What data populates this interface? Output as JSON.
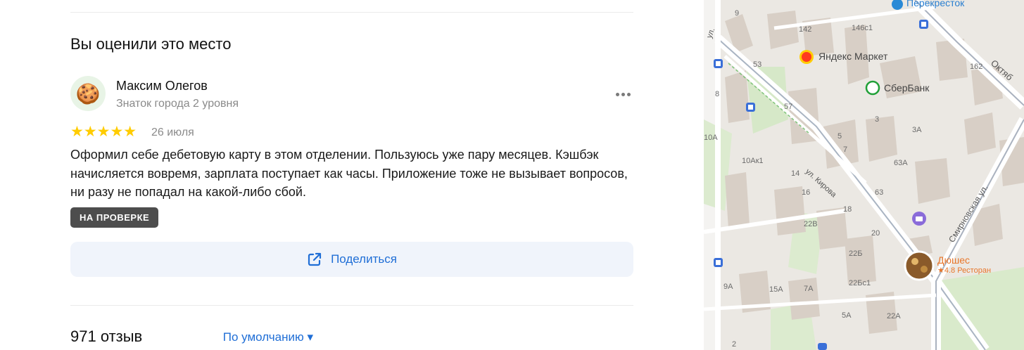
{
  "review_section": {
    "title": "Вы оценили это место",
    "author": {
      "name": "Максим Олегов",
      "level": "Знаток города 2 уровня",
      "avatar_emoji": "🍪"
    },
    "rating_stars": "★★★★★",
    "date": "26 июля",
    "text": "Оформил себе дебетовую карту в этом отделении. Пользуюсь уже пару месяцев. Кэшбэк начисляется вовремя, зарплата поступает как часы. Приложение тоже не вызывает вопросов, ни разу не попадал на какой-либо сбой.",
    "status_badge": "НА ПРОВЕРКЕ",
    "share_label": "Поделиться"
  },
  "reviews_header": {
    "count": "971 отзыв",
    "sort_label": "По умолчанию ▾"
  },
  "map": {
    "pois": {
      "perekrestok": "Перекресток",
      "yandex_market": "Яндекс Маркет",
      "sberbank": "СберБанк",
      "restaurant_name": "Дюшес",
      "restaurant_rating": "★4.8 Ресторан"
    },
    "streets": {
      "kirova": "ул. Кирова",
      "smirnovskaya": "Смирновская ул.",
      "oktyab": "Октяб",
      "ul": "ул."
    },
    "house_numbers": [
      "9",
      "142",
      "146с1",
      "53",
      "162",
      "8",
      "57",
      "3",
      "10А",
      "5",
      "3А",
      "10Ак1",
      "7",
      "63А",
      "14",
      "63",
      "16",
      "18",
      "22В",
      "20",
      "22Б",
      "15А",
      "7А",
      "22Бс1",
      "9А",
      "5А",
      "22А",
      "2"
    ]
  },
  "colors": {
    "accent_blue": "#1f6ed6",
    "star_yellow": "#ffcc00",
    "badge_bg": "#4d4d4d",
    "sber_green": "#21a038",
    "restaurant_orange": "#e8762a"
  }
}
